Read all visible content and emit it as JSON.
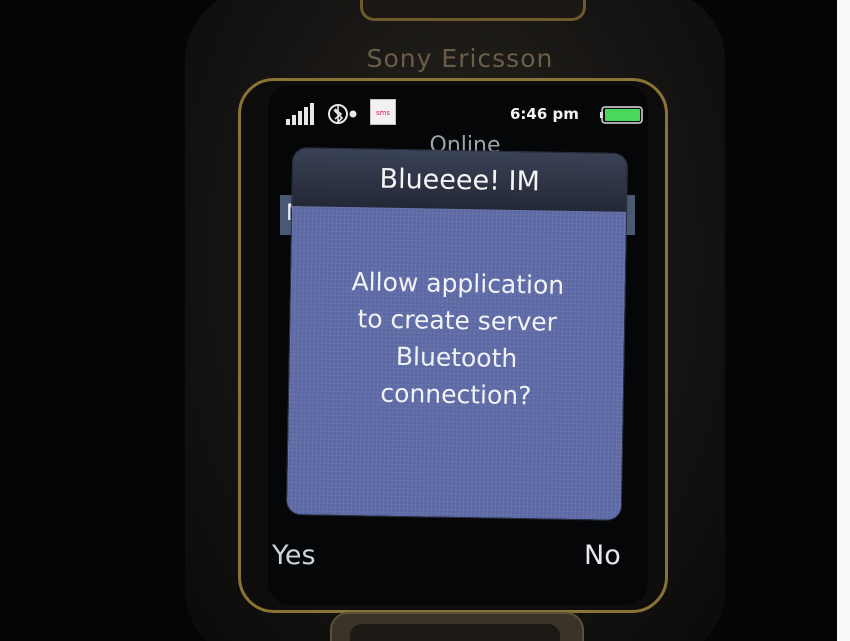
{
  "phone": {
    "brand": "Sony Ericsson"
  },
  "status_bar": {
    "clock": "6:46 pm",
    "app_icon_text": "sms",
    "icons": [
      "signal-strength-icon",
      "bluetooth-icon",
      "app-icon",
      "battery-icon"
    ]
  },
  "background_screen": {
    "title_partial": "Online",
    "row_partial": "N"
  },
  "dialog": {
    "title": "Blueeee! IM",
    "message_lines": [
      "Allow application",
      "to create server",
      "Bluetooth",
      "connection?"
    ]
  },
  "softkeys": {
    "left": "Yes",
    "right": "No"
  },
  "colors": {
    "dialog_body": "#5d69a4",
    "dialog_header": "#2a3040",
    "phone_trim": "#8a7435",
    "battery_fill": "#49d85a"
  }
}
